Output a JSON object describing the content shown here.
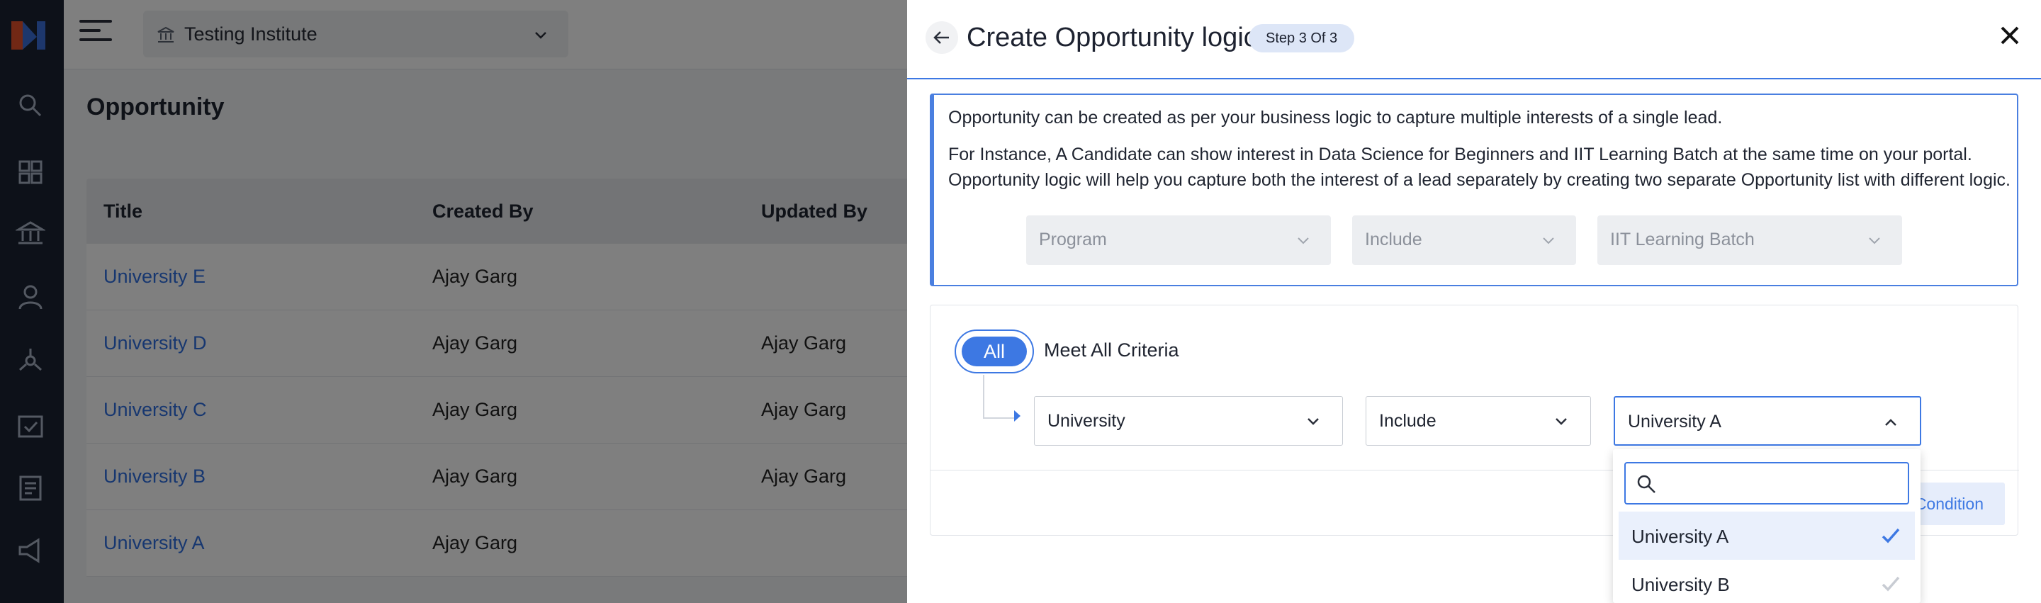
{
  "app": {
    "institute": "Testing Institute",
    "page_title": "Opportunity"
  },
  "table": {
    "headers": [
      "Title",
      "Created By",
      "Updated By"
    ],
    "rows": [
      {
        "title": "University E",
        "created_by": "Ajay Garg",
        "updated_by": ""
      },
      {
        "title": "University D",
        "created_by": "Ajay Garg",
        "updated_by": "Ajay Garg"
      },
      {
        "title": "University C",
        "created_by": "Ajay Garg",
        "updated_by": "Ajay Garg"
      },
      {
        "title": "University B",
        "created_by": "Ajay Garg",
        "updated_by": "Ajay Garg"
      },
      {
        "title": "University A",
        "created_by": "Ajay Garg",
        "updated_by": ""
      }
    ]
  },
  "drawer": {
    "title": "Create Opportunity logic",
    "step": "Step 3 Of 3",
    "info": {
      "line1": "Opportunity can be created as per your business logic to capture multiple interests of a single lead.",
      "line2": "For Instance, A Candidate can show interest in Data Science for Beginners and IIT Learning Batch at the same time on your portal.",
      "line3": "Opportunity logic will help you capture both the interest of a lead separately by creating two separate Opportunity list with different logic.",
      "example": {
        "field": "Program",
        "operator": "Include",
        "value": "IIT Learning Batch"
      }
    },
    "criteria": {
      "all_label": "All",
      "meet_label": "Meet All Criteria",
      "field": "University",
      "operator": "Include",
      "value": "University A",
      "add_condition_label": "Condition"
    },
    "dropdown": {
      "search_placeholder": "",
      "options": [
        {
          "label": "University A",
          "selected": true
        },
        {
          "label": "University B",
          "selected": false
        }
      ]
    }
  },
  "colors": {
    "accent": "#3d78e3",
    "link": "#2f6fe0",
    "rail": "#1b2333"
  }
}
